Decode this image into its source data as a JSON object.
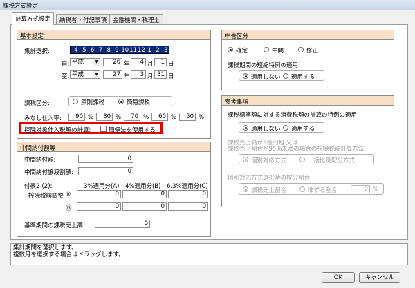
{
  "window": {
    "title": "課税方式設定"
  },
  "tabs": [
    "計算方式設定",
    "納税者・付記事項",
    "金融機関・税理士"
  ],
  "basic": {
    "header": "基本設定",
    "period_label": "集計選択:",
    "months": [
      "4",
      "5",
      "6",
      "7",
      "8",
      "9",
      "10",
      "11",
      "12",
      "1",
      "2",
      "3"
    ],
    "from_label": "自:",
    "to_label": "至:",
    "era": "平成",
    "from": {
      "year": "26",
      "month": "4",
      "day": "1"
    },
    "to": {
      "year": "27",
      "month": "3",
      "day": "31"
    },
    "unit_year": "年",
    "unit_month": "月",
    "unit_day": "日",
    "tax_class_label": "課税区分:",
    "tax_class_options": [
      "原則課税",
      "簡易課税"
    ],
    "tax_class_selected": 1,
    "deemed_label": "みなし仕入率:",
    "deemed_rates": [
      "90",
      "80",
      "70",
      "60",
      "50"
    ],
    "percent": "%",
    "deduction_label": "控除対象仕入税額の計算:",
    "deduction_checkbox": "簡便法を使用する",
    "highlight_color": "#e00000"
  },
  "interim": {
    "header": "中間納付額等",
    "interim_tax_label": "中間納付額:",
    "interim_tax_value": "0",
    "interim_transfer_label": "中間納付譲渡割額:",
    "interim_transfer_value": "0",
    "table_label": "付表2-(2):",
    "col_headers": [
      "3%適用分(A)",
      "4%適用分(B)",
      "6.3%適用分(C)"
    ],
    "row_label": "控除税額調整",
    "rows": [
      {
        "mark": "⑧",
        "values": [
          "0",
          "0",
          "0"
        ]
      },
      {
        "mark": "⑬",
        "values": [
          "0",
          "0",
          "0"
        ]
      }
    ],
    "base_sales_label": "基準期間の課税売上高:",
    "base_sales_value": "0"
  },
  "filing": {
    "header": "申告区分",
    "options": [
      "確定",
      "中間",
      "修正"
    ],
    "selected": 0,
    "special_label": "課税期間の短縮特例の適用:",
    "special_options": [
      "適用しない",
      "適用する"
    ],
    "special_selected": 0
  },
  "reference": {
    "header": "参考事項",
    "q1_label": "課税標準額に対する消費税額の計算の特例の適用:",
    "q1_options": [
      "適用しない",
      "適用する"
    ],
    "q1_selected": 0,
    "q2_label_1": "課税売上高が5億円超 又は",
    "q2_label_2": "課税売上割合が95%未満の場合の控除税額計算方法:",
    "q2_options": [
      "個別対応方式",
      "一括比例配分方式"
    ],
    "q2_selected": 0,
    "q3_label": "個別対応方式選択時の按分割合:",
    "q3_options": [
      "課税売上割合",
      "准ずる割合"
    ],
    "q3_selected": 0,
    "q3_value": "0",
    "percent": "%"
  },
  "message": {
    "line1": "集計期間を選択します。",
    "line2": "複数月を選択する場合はドラッグします。"
  },
  "buttons": {
    "ok": "OK",
    "cancel": "キャンセル"
  }
}
